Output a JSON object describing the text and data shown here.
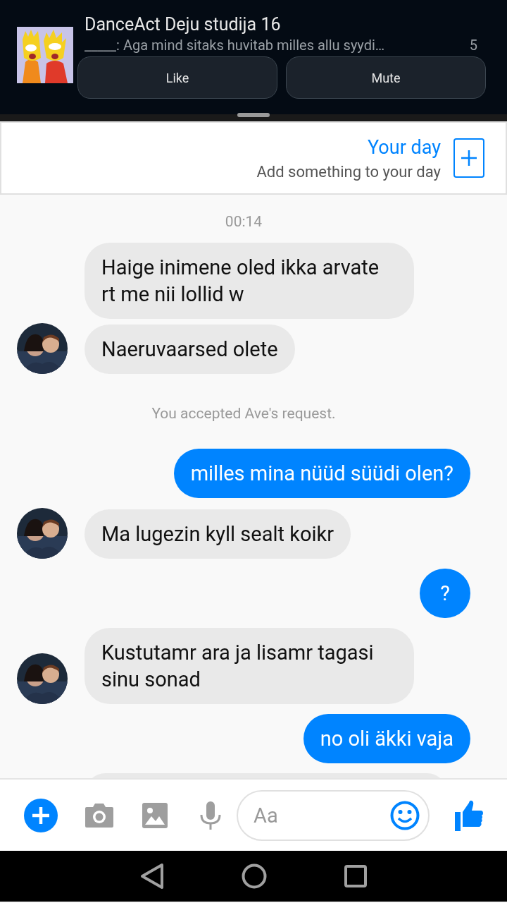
{
  "notification": {
    "title": "DanceAct Deju studija 16",
    "text": "_____: Aga mind sitaks huvitab milles allu syydi…",
    "count": "5",
    "actions": [
      "Like",
      "Mute"
    ]
  },
  "your_day": {
    "title": "Your day",
    "subtitle": "Add something to your day"
  },
  "messages": [
    {
      "kind": "time",
      "text": "00:14"
    },
    {
      "kind": "incoming",
      "text": "Haige inimene oled ikka arvate rt me nii lollid w",
      "avatar": false
    },
    {
      "kind": "incoming",
      "text": "Naeruvaarsed olete",
      "avatar": true
    },
    {
      "kind": "system",
      "text": "You accepted Ave's request."
    },
    {
      "kind": "outgoing",
      "text": "milles mina nüüd süüdi olen?"
    },
    {
      "kind": "incoming",
      "text": "Ma lugezin kyll sealt koikr",
      "avatar": true
    },
    {
      "kind": "outgoing",
      "text": "?"
    },
    {
      "kind": "incoming",
      "text": "Kustutamr ara ja lisamr tagasi sinu sonad",
      "avatar": true
    },
    {
      "kind": "outgoing",
      "text": "no oli äkki vaja"
    },
    {
      "kind": "partial"
    }
  ],
  "composer": {
    "placeholder": "Aa"
  }
}
